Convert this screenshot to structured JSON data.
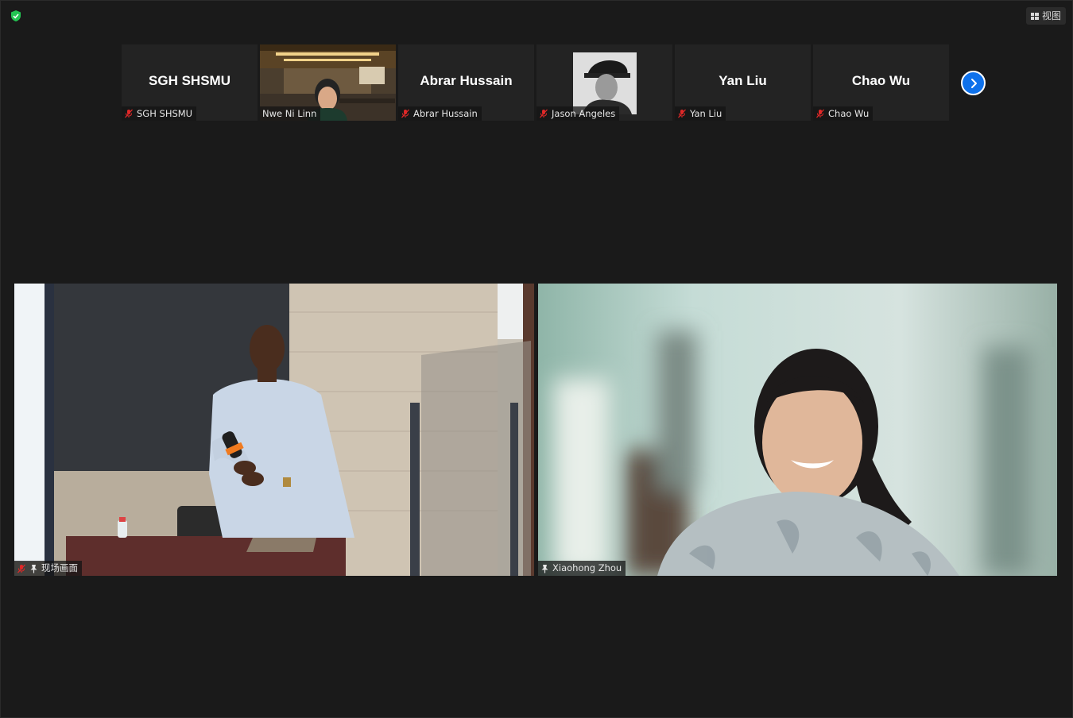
{
  "toolbar": {
    "view_label": "视图"
  },
  "strip": {
    "tiles": [
      {
        "display_name": "SGH SHSMU",
        "label": "SGH SHSMU",
        "type": "name"
      },
      {
        "display_name": "",
        "label": "Nwe Ni Linn",
        "type": "video"
      },
      {
        "display_name": "Abrar Hussain",
        "label": "Abrar Hussain",
        "type": "name"
      },
      {
        "display_name": "",
        "label": "Jason Angeles",
        "type": "avatar"
      },
      {
        "display_name": "Yan Liu",
        "label": "Yan Liu",
        "type": "name"
      },
      {
        "display_name": "Chao Wu",
        "label": "Chao Wu",
        "type": "name"
      }
    ]
  },
  "main": {
    "left": {
      "label": "现场画面"
    },
    "right": {
      "label": "Xiaohong Zhou"
    }
  },
  "colors": {
    "background": "#1a1a1a",
    "tile": "#232323",
    "accent": "#0e71eb",
    "mic_off": "#e02828",
    "shield": "#23c552"
  }
}
